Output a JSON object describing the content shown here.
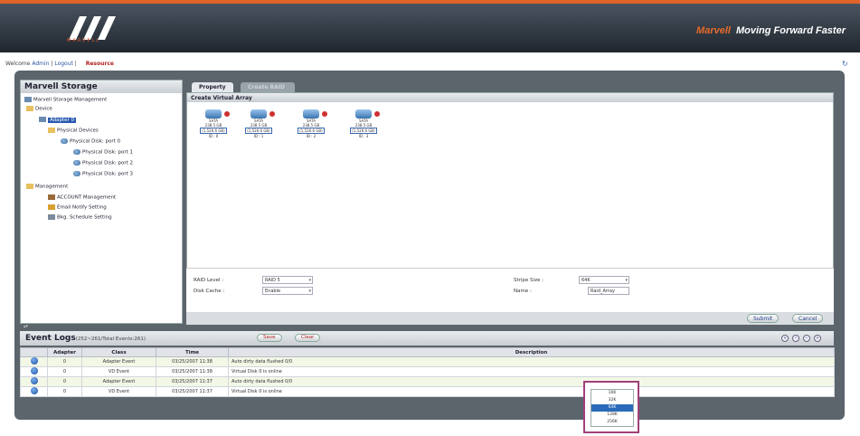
{
  "header": {
    "logo_text": "MARVELL",
    "slogan_brand": "Marvell",
    "slogan": "Moving Forward Faster"
  },
  "topbar": {
    "welcome": "Welcome",
    "user": "Admin",
    "logout": "Logout",
    "resource": "Resource"
  },
  "tree": {
    "title": "Marvell Storage",
    "items": [
      {
        "label": "Marvell Storage Management"
      },
      {
        "label": "Device"
      },
      {
        "label": "Adapter 0"
      },
      {
        "label": "Physical Devices"
      },
      {
        "label": "Physical Disk: port 0"
      },
      {
        "label": "Physical Disk: port 1"
      },
      {
        "label": "Physical Disk: port 2"
      },
      {
        "label": "Physical Disk: port 3"
      },
      {
        "label": "Management"
      },
      {
        "label": "ACCOUNT Management"
      },
      {
        "label": "Email Notify Setting"
      },
      {
        "label": "Bkg. Schedule Setting"
      }
    ]
  },
  "tabs": {
    "active": "Property",
    "inactive": "Create RAID"
  },
  "content": {
    "title": "Create Virtual Array",
    "drives": [
      {
        "type": "SATA",
        "size": "238.5 GB",
        "capacity": "(1,526.6 GB)",
        "id": "ID : 0"
      },
      {
        "type": "SATA",
        "size": "238.5 GB",
        "capacity": "(1,526.6 GB)",
        "id": "ID : 1"
      },
      {
        "type": "SATA",
        "size": "238.5 GB",
        "capacity": "(1,526.6 GB)",
        "id": "ID : 2"
      },
      {
        "type": "SATA",
        "size": "238.5 GB",
        "capacity": "(1,526.6 GB)",
        "id": "ID : 3"
      }
    ]
  },
  "form": {
    "raid_level_label": "RAID Level :",
    "raid_level_value": "RAID 5",
    "disk_cache_label": "Disk Cache :",
    "disk_cache_value": "Enable",
    "stripe_size_label": "Stripe Size :",
    "stripe_size_value": "64K",
    "name_label": "Name :",
    "name_value": "Raid_Array"
  },
  "buttons": {
    "submit": "Submit",
    "cancel": "Cancel"
  },
  "logs": {
    "title": "Event Logs",
    "range": "(252~261/Total Events:261)",
    "save": "Save",
    "clear": "Clear",
    "nav": {
      "first": "«",
      "prev": "‹",
      "next": "›",
      "last": "»"
    },
    "columns": [
      "Adapter",
      "Class",
      "Time",
      "Description"
    ],
    "rows": [
      {
        "adapter": "0",
        "class": "Adapter Event",
        "time": "03/25/2007 11:38",
        "description": "Auto dirty data flushed 0/0"
      },
      {
        "adapter": "0",
        "class": "VD Event",
        "time": "03/25/2007 11:38",
        "description": "Virtual Disk 0 is online"
      },
      {
        "adapter": "0",
        "class": "Adapter Event",
        "time": "03/25/2007 11:37",
        "description": "Auto dirty data flushed 0/0"
      },
      {
        "adapter": "0",
        "class": "VD Event",
        "time": "03/25/2007 11:37",
        "description": "Virtual Disk 0 is online"
      }
    ]
  },
  "stripe_popup": {
    "options": [
      "16K",
      "32K",
      "64K",
      "128K",
      "256K"
    ],
    "selected": "64K"
  },
  "colors": {
    "header_accent": "#e0632a",
    "frame": "#5c646c",
    "highlight": "#2a6ab8",
    "popup_border": "#a0407a"
  }
}
